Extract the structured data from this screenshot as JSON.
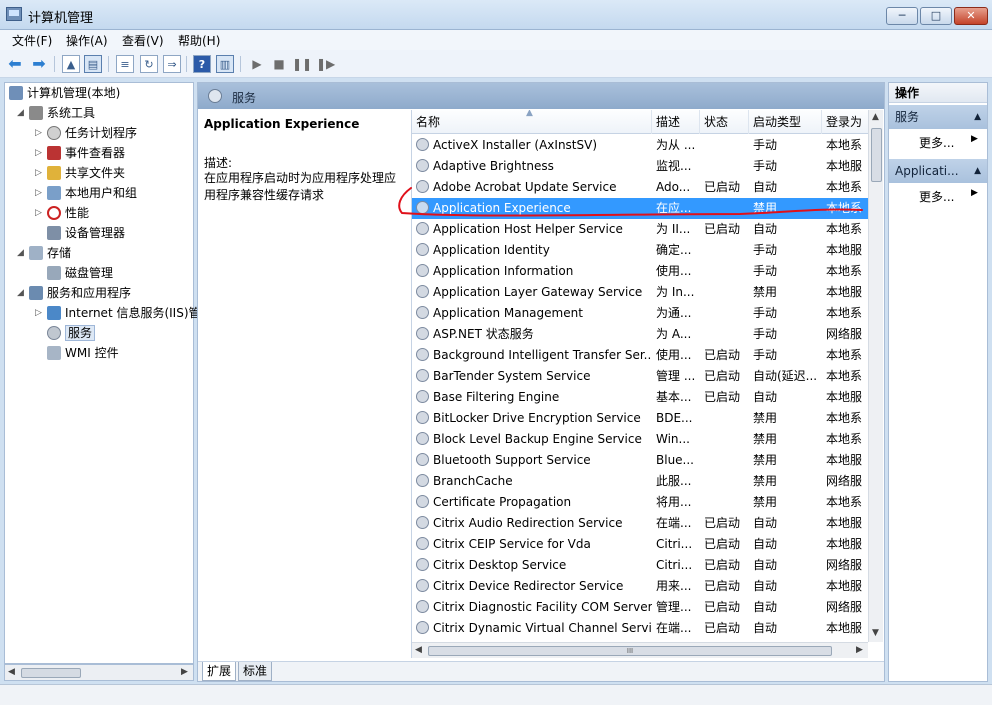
{
  "window": {
    "title": "计算机管理",
    "min": "─",
    "max": "□",
    "close": "✕"
  },
  "menu": [
    "文件(F)",
    "操作(A)",
    "查看(V)",
    "帮助(H)"
  ],
  "toolbar": {
    "icons": [
      "back-icon",
      "forward-icon",
      "up-folder-icon",
      "show-hide-tree-icon",
      "export-list-icon",
      "refresh-icon",
      "properties-icon",
      "help-icon",
      "action-pane-icon",
      "start-icon",
      "stop-icon",
      "pause-icon",
      "restart-icon"
    ]
  },
  "tree": {
    "root": "计算机管理(本地)",
    "system_tools": "系统工具",
    "task_scheduler": "任务计划程序",
    "event_viewer": "事件查看器",
    "shared_folders": "共享文件夹",
    "local_users": "本地用户和组",
    "performance": "性能",
    "device_manager": "设备管理器",
    "storage": "存储",
    "disk_management": "磁盘管理",
    "services_apps": "服务和应用程序",
    "iis": "Internet 信息服务(IIS)管",
    "services": "服务",
    "wmi": "WMI 控件"
  },
  "center": {
    "header": "服务",
    "selected_name": "Application Experience",
    "desc_label": "描述:",
    "desc_text": "在应用程序启动时为应用程序处理应用程序兼容性缓存请求",
    "columns": [
      "名称",
      "描述",
      "状态",
      "启动类型",
      "登录为"
    ],
    "tabs": [
      "扩展",
      "标准"
    ]
  },
  "services": [
    {
      "name": "ActiveX Installer (AxInstSV)",
      "desc": "为从 ...",
      "status": "",
      "start": "手动",
      "logon": "本地系"
    },
    {
      "name": "Adaptive Brightness",
      "desc": "监视...",
      "status": "",
      "start": "手动",
      "logon": "本地服"
    },
    {
      "name": "Adobe Acrobat Update Service",
      "desc": "Ado...",
      "status": "已启动",
      "start": "自动",
      "logon": "本地系"
    },
    {
      "name": "Application Experience",
      "desc": "在应...",
      "status": "",
      "start": "禁用",
      "logon": "本地系"
    },
    {
      "name": "Application Host Helper Service",
      "desc": "为 II...",
      "status": "已启动",
      "start": "自动",
      "logon": "本地系"
    },
    {
      "name": "Application Identity",
      "desc": "确定...",
      "status": "",
      "start": "手动",
      "logon": "本地服"
    },
    {
      "name": "Application Information",
      "desc": "使用...",
      "status": "",
      "start": "手动",
      "logon": "本地系"
    },
    {
      "name": "Application Layer Gateway Service",
      "desc": "为 In...",
      "status": "",
      "start": "禁用",
      "logon": "本地服"
    },
    {
      "name": "Application Management",
      "desc": "为通...",
      "status": "",
      "start": "手动",
      "logon": "本地系"
    },
    {
      "name": "ASP.NET 状态服务",
      "desc": "为 A...",
      "status": "",
      "start": "手动",
      "logon": "网络服"
    },
    {
      "name": "Background Intelligent Transfer Ser...",
      "desc": "使用...",
      "status": "已启动",
      "start": "手动",
      "logon": "本地系"
    },
    {
      "name": "BarTender System Service",
      "desc": "管理 ...",
      "status": "已启动",
      "start": "自动(延迟...",
      "logon": "本地系"
    },
    {
      "name": "Base Filtering Engine",
      "desc": "基本...",
      "status": "已启动",
      "start": "自动",
      "logon": "本地服"
    },
    {
      "name": "BitLocker Drive Encryption Service",
      "desc": "BDE...",
      "status": "",
      "start": "禁用",
      "logon": "本地系"
    },
    {
      "name": "Block Level Backup Engine Service",
      "desc": "Win...",
      "status": "",
      "start": "禁用",
      "logon": "本地系"
    },
    {
      "name": "Bluetooth Support Service",
      "desc": "Blue...",
      "status": "",
      "start": "禁用",
      "logon": "本地服"
    },
    {
      "name": "BranchCache",
      "desc": "此服...",
      "status": "",
      "start": "禁用",
      "logon": "网络服"
    },
    {
      "name": "Certificate Propagation",
      "desc": "将用...",
      "status": "",
      "start": "禁用",
      "logon": "本地系"
    },
    {
      "name": "Citrix Audio Redirection Service",
      "desc": "在端...",
      "status": "已启动",
      "start": "自动",
      "logon": "本地服"
    },
    {
      "name": "Citrix CEIP Service for Vda",
      "desc": "Citri...",
      "status": "已启动",
      "start": "自动",
      "logon": "本地服"
    },
    {
      "name": "Citrix Desktop Service",
      "desc": "Citri...",
      "status": "已启动",
      "start": "自动",
      "logon": "网络服"
    },
    {
      "name": "Citrix Device Redirector Service",
      "desc": "用来...",
      "status": "已启动",
      "start": "自动",
      "logon": "本地服"
    },
    {
      "name": "Citrix Diagnostic Facility COM Server",
      "desc": "管理...",
      "status": "已启动",
      "start": "自动",
      "logon": "网络服"
    },
    {
      "name": "Citrix Dynamic Virtual Channel Servi...",
      "desc": "在端...",
      "status": "已启动",
      "start": "自动",
      "logon": "本地服"
    }
  ],
  "actions": {
    "header": "操作",
    "section1": "服务",
    "more1": "更多...",
    "section2": "Applicati...",
    "more2": "更多..."
  },
  "scroll": {
    "thumb_grip": "III"
  },
  "colors": {
    "selection": "#3399ff",
    "annotation": "#e0101a",
    "pane_header": "#9bb5d4"
  }
}
